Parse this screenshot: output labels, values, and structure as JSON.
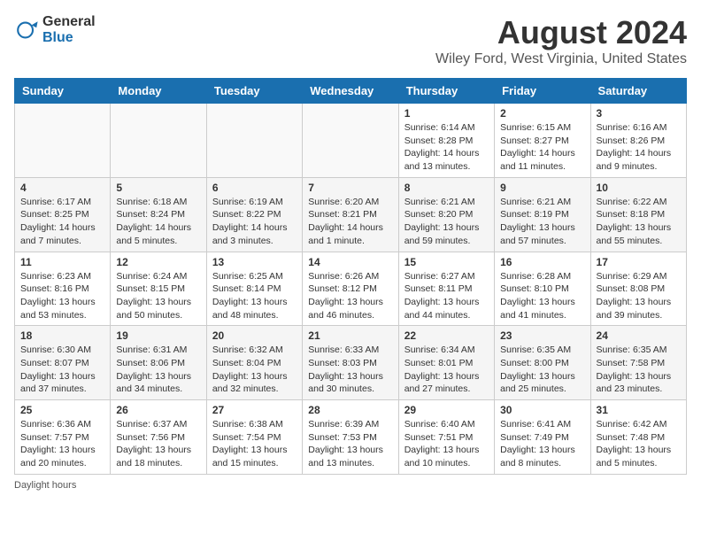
{
  "header": {
    "logo_general": "General",
    "logo_blue": "Blue",
    "title": "August 2024",
    "subtitle": "Wiley Ford, West Virginia, United States"
  },
  "weekdays": [
    "Sunday",
    "Monday",
    "Tuesday",
    "Wednesday",
    "Thursday",
    "Friday",
    "Saturday"
  ],
  "weeks": [
    [
      {
        "day": "",
        "info": ""
      },
      {
        "day": "",
        "info": ""
      },
      {
        "day": "",
        "info": ""
      },
      {
        "day": "",
        "info": ""
      },
      {
        "day": "1",
        "info": "Sunrise: 6:14 AM\nSunset: 8:28 PM\nDaylight: 14 hours and 13 minutes."
      },
      {
        "day": "2",
        "info": "Sunrise: 6:15 AM\nSunset: 8:27 PM\nDaylight: 14 hours and 11 minutes."
      },
      {
        "day": "3",
        "info": "Sunrise: 6:16 AM\nSunset: 8:26 PM\nDaylight: 14 hours and 9 minutes."
      }
    ],
    [
      {
        "day": "4",
        "info": "Sunrise: 6:17 AM\nSunset: 8:25 PM\nDaylight: 14 hours and 7 minutes."
      },
      {
        "day": "5",
        "info": "Sunrise: 6:18 AM\nSunset: 8:24 PM\nDaylight: 14 hours and 5 minutes."
      },
      {
        "day": "6",
        "info": "Sunrise: 6:19 AM\nSunset: 8:22 PM\nDaylight: 14 hours and 3 minutes."
      },
      {
        "day": "7",
        "info": "Sunrise: 6:20 AM\nSunset: 8:21 PM\nDaylight: 14 hours and 1 minute."
      },
      {
        "day": "8",
        "info": "Sunrise: 6:21 AM\nSunset: 8:20 PM\nDaylight: 13 hours and 59 minutes."
      },
      {
        "day": "9",
        "info": "Sunrise: 6:21 AM\nSunset: 8:19 PM\nDaylight: 13 hours and 57 minutes."
      },
      {
        "day": "10",
        "info": "Sunrise: 6:22 AM\nSunset: 8:18 PM\nDaylight: 13 hours and 55 minutes."
      }
    ],
    [
      {
        "day": "11",
        "info": "Sunrise: 6:23 AM\nSunset: 8:16 PM\nDaylight: 13 hours and 53 minutes."
      },
      {
        "day": "12",
        "info": "Sunrise: 6:24 AM\nSunset: 8:15 PM\nDaylight: 13 hours and 50 minutes."
      },
      {
        "day": "13",
        "info": "Sunrise: 6:25 AM\nSunset: 8:14 PM\nDaylight: 13 hours and 48 minutes."
      },
      {
        "day": "14",
        "info": "Sunrise: 6:26 AM\nSunset: 8:12 PM\nDaylight: 13 hours and 46 minutes."
      },
      {
        "day": "15",
        "info": "Sunrise: 6:27 AM\nSunset: 8:11 PM\nDaylight: 13 hours and 44 minutes."
      },
      {
        "day": "16",
        "info": "Sunrise: 6:28 AM\nSunset: 8:10 PM\nDaylight: 13 hours and 41 minutes."
      },
      {
        "day": "17",
        "info": "Sunrise: 6:29 AM\nSunset: 8:08 PM\nDaylight: 13 hours and 39 minutes."
      }
    ],
    [
      {
        "day": "18",
        "info": "Sunrise: 6:30 AM\nSunset: 8:07 PM\nDaylight: 13 hours and 37 minutes."
      },
      {
        "day": "19",
        "info": "Sunrise: 6:31 AM\nSunset: 8:06 PM\nDaylight: 13 hours and 34 minutes."
      },
      {
        "day": "20",
        "info": "Sunrise: 6:32 AM\nSunset: 8:04 PM\nDaylight: 13 hours and 32 minutes."
      },
      {
        "day": "21",
        "info": "Sunrise: 6:33 AM\nSunset: 8:03 PM\nDaylight: 13 hours and 30 minutes."
      },
      {
        "day": "22",
        "info": "Sunrise: 6:34 AM\nSunset: 8:01 PM\nDaylight: 13 hours and 27 minutes."
      },
      {
        "day": "23",
        "info": "Sunrise: 6:35 AM\nSunset: 8:00 PM\nDaylight: 13 hours and 25 minutes."
      },
      {
        "day": "24",
        "info": "Sunrise: 6:35 AM\nSunset: 7:58 PM\nDaylight: 13 hours and 23 minutes."
      }
    ],
    [
      {
        "day": "25",
        "info": "Sunrise: 6:36 AM\nSunset: 7:57 PM\nDaylight: 13 hours and 20 minutes."
      },
      {
        "day": "26",
        "info": "Sunrise: 6:37 AM\nSunset: 7:56 PM\nDaylight: 13 hours and 18 minutes."
      },
      {
        "day": "27",
        "info": "Sunrise: 6:38 AM\nSunset: 7:54 PM\nDaylight: 13 hours and 15 minutes."
      },
      {
        "day": "28",
        "info": "Sunrise: 6:39 AM\nSunset: 7:53 PM\nDaylight: 13 hours and 13 minutes."
      },
      {
        "day": "29",
        "info": "Sunrise: 6:40 AM\nSunset: 7:51 PM\nDaylight: 13 hours and 10 minutes."
      },
      {
        "day": "30",
        "info": "Sunrise: 6:41 AM\nSunset: 7:49 PM\nDaylight: 13 hours and 8 minutes."
      },
      {
        "day": "31",
        "info": "Sunrise: 6:42 AM\nSunset: 7:48 PM\nDaylight: 13 hours and 5 minutes."
      }
    ]
  ],
  "footer": "Daylight hours"
}
